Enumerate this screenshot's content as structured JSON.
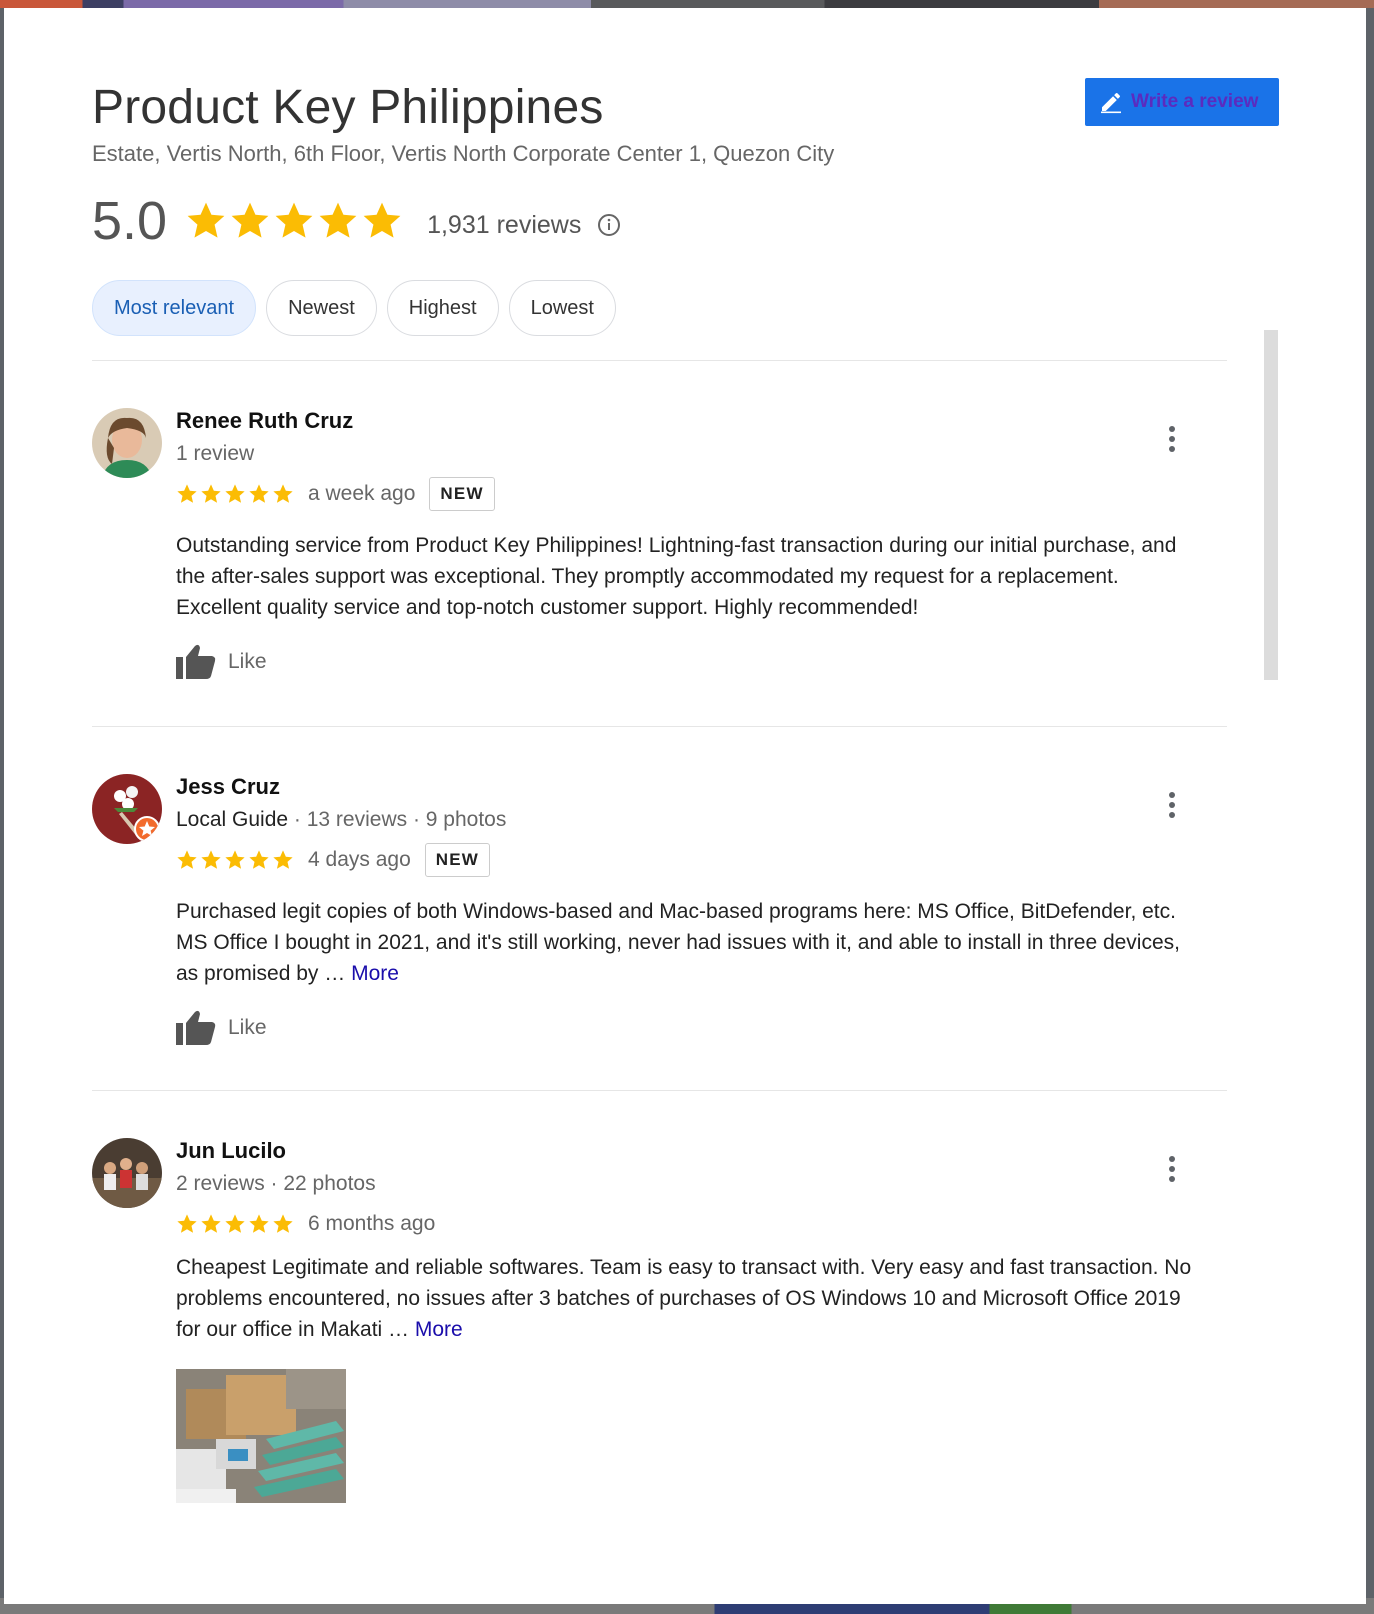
{
  "business": {
    "name": "Product Key Philippines",
    "address": "Estate, Vertis North, 6th Floor, Vertis North Corporate Center 1, Quezon City",
    "rating": "5.0",
    "review_count": "1,931 reviews",
    "write_review_label": "Write a review",
    "accent_color": "#1a73e8",
    "star_color": "#fbbc04"
  },
  "sort": {
    "options": [
      "Most relevant",
      "Newest",
      "Highest",
      "Lowest"
    ],
    "selected": "Most relevant"
  },
  "reviews": [
    {
      "name": "Renee Ruth Cruz",
      "meta_role": "",
      "meta": "1 review",
      "stars": 5,
      "time": "a week ago",
      "badge": "NEW",
      "text": "Outstanding service from Product Key Philippines! Lightning-fast transaction during our initial purchase, and the after-sales support was exceptional. They promptly accommodated my request for a replacement. Excellent quality service and top-notch customer support. Highly recommended!",
      "more_label": "",
      "like_label": "Like"
    },
    {
      "name": "Jess Cruz",
      "meta_role": "Local Guide",
      "meta": " · 13 reviews · 9 photos",
      "stars": 5,
      "time": "4 days ago",
      "badge": "NEW",
      "text": "Purchased legit copies of both Windows-based and Mac-based programs here: MS Office, BitDefender, etc. MS Office I bought in 2021, and it's still working, never had issues with it, and able to install in three devices, as promised by … ",
      "more_label": "More",
      "like_label": "Like"
    },
    {
      "name": "Jun Lucilo",
      "meta_role": "",
      "meta": "2 reviews · 22 photos",
      "stars": 5,
      "time": "6 months ago",
      "badge": "",
      "text": "Cheapest Legitimate and reliable softwares. Team is easy to transact with. Very easy and fast transaction. No problems encountered, no issues after 3 batches of purchases of OS Windows 10 and Microsoft Office 2019 for our office in Makati … ",
      "more_label": "More",
      "like_label": ""
    }
  ]
}
